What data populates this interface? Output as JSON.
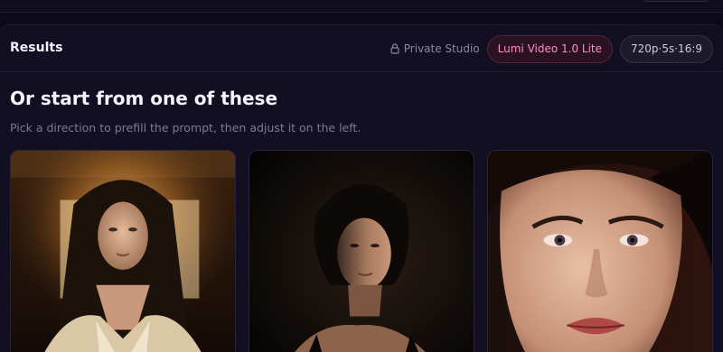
{
  "header": {
    "title": "Results",
    "private_label": "Private Studio",
    "model_label": "Lumi Video 1.0 Lite",
    "spec_label": "720p·5s·16:9"
  },
  "section": {
    "title": "Or start from one of these",
    "subtitle": "Pick a direction to prefill the prompt, then adjust it on the left."
  },
  "colors": {
    "background": "#0c0a18",
    "accent_pink": "#ff8cc2",
    "muted_text": "#7f7993"
  },
  "icons": [
    "lock-icon"
  ]
}
